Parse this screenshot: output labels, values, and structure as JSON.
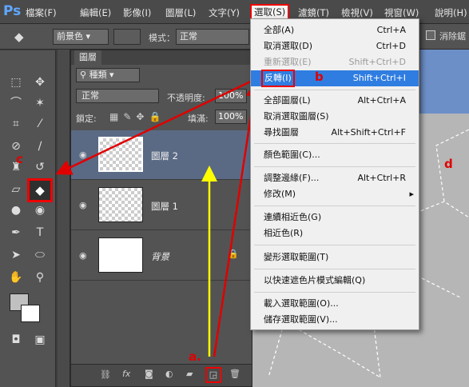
{
  "app": {
    "logo": "Ps"
  },
  "menubar": [
    "檔案(F)",
    "編輯(E)",
    "影像(I)",
    "圖層(L)",
    "文字(Y)",
    "選取(S)",
    "濾鏡(T)",
    "檢視(V)",
    "視窗(W)",
    "說明(H)"
  ],
  "options": {
    "fill_source": "前景色",
    "mode_label": "模式：",
    "mode_value": "正常",
    "erase_label": "消除鋸"
  },
  "panel": {
    "tab": "圖層",
    "filter": "種類",
    "blend_mode": "正常",
    "opacity_label": "不透明度:",
    "opacity_value": "100%",
    "lock_label": "鎖定:",
    "fill_label": "填滿:",
    "fill_value": "100%"
  },
  "layers": [
    {
      "name": "圖層 2"
    },
    {
      "name": "圖層 1"
    },
    {
      "name": "背景"
    }
  ],
  "menu": {
    "items": [
      {
        "label": "全部(A)",
        "shortcut": "Ctrl+A"
      },
      {
        "label": "取消選取(D)",
        "shortcut": "Ctrl+D"
      },
      {
        "label": "重新選取(E)",
        "shortcut": "Shift+Ctrl+D",
        "disabled": true
      },
      {
        "label": "反轉(I)",
        "shortcut": "Shift+Ctrl+I",
        "highlight": true
      },
      {
        "label": "全部圖層(L)",
        "shortcut": "Alt+Ctrl+A"
      },
      {
        "label": "取消選取圖層(S)",
        "shortcut": ""
      },
      {
        "label": "尋找圖層",
        "shortcut": "Alt+Shift+Ctrl+F"
      },
      {
        "label": "顏色範圍(C)...",
        "shortcut": ""
      },
      {
        "label": "調整邊緣(F)...",
        "shortcut": "Alt+Ctrl+R"
      },
      {
        "label": "修改(M)",
        "shortcut": "▸"
      },
      {
        "label": "連續相近色(G)",
        "shortcut": ""
      },
      {
        "label": "相近色(R)",
        "shortcut": ""
      },
      {
        "label": "變形選取範圍(T)",
        "shortcut": ""
      },
      {
        "label": "以快速遮色片模式編輯(Q)",
        "shortcut": ""
      },
      {
        "label": "載入選取範圍(O)...",
        "shortcut": ""
      },
      {
        "label": "儲存選取範圍(V)...",
        "shortcut": ""
      }
    ]
  },
  "annotations": {
    "a": "a.",
    "b": "b",
    "c": "c",
    "d": "d"
  },
  "colors": {
    "annot_red": "#e00000",
    "arrow_yellow": "#ffff00",
    "highlight": "#2f7de1"
  },
  "icons": [
    "paint-bucket-icon",
    "move-icon",
    "marquee-icon",
    "lasso-icon",
    "magic-wand-icon",
    "crop-icon",
    "eyedropper-icon",
    "healing-icon",
    "brush-icon",
    "stamp-icon",
    "history-brush-icon",
    "eraser-icon",
    "blur-icon",
    "dodge-icon",
    "pen-icon",
    "text-icon",
    "path-select-icon",
    "ellipse-icon",
    "hand-icon",
    "zoom-icon",
    "eye-icon",
    "link-icon",
    "fx-icon",
    "mask-icon",
    "adjustment-icon",
    "folder-icon",
    "new-layer-icon",
    "trash-icon"
  ]
}
